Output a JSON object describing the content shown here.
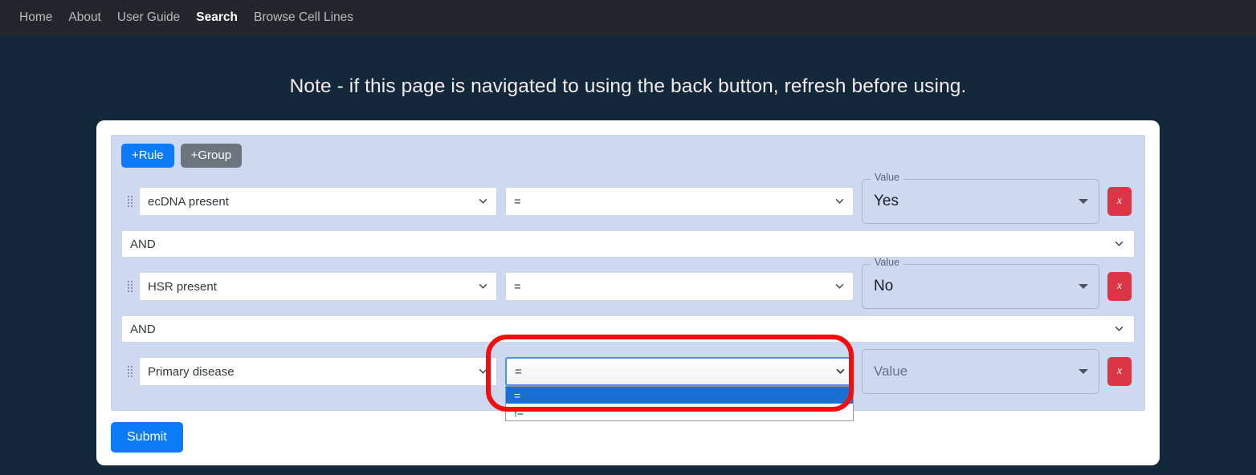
{
  "nav": {
    "items": [
      {
        "label": "Home",
        "active": false
      },
      {
        "label": "About",
        "active": false
      },
      {
        "label": "User Guide",
        "active": false
      },
      {
        "label": "Search",
        "active": true
      },
      {
        "label": "Browse Cell Lines",
        "active": false
      }
    ]
  },
  "page": {
    "note": "Note - if this page is navigated to using the back button, refresh before using.",
    "background_color": "#14283c"
  },
  "query_builder": {
    "add_rule_label": "+Rule",
    "add_group_label": "+Group",
    "remove_label": "x",
    "value_field_label": "Value",
    "value_placeholder": "Value",
    "accent_color": "#0d7bf7",
    "group_background": "#ccd9f0",
    "danger_color": "#dc3545",
    "rules": [
      {
        "field": "ecDNA present",
        "operator": "=",
        "value": "Yes",
        "has_value": true
      },
      {
        "field": "HSR present",
        "operator": "=",
        "value": "No",
        "has_value": true
      },
      {
        "field": "Primary disease",
        "operator": "=",
        "value": "Value",
        "has_value": false
      }
    ],
    "combinators": [
      {
        "value": "AND"
      },
      {
        "value": "AND"
      }
    ],
    "open_dropdown": {
      "selected": "=",
      "options": [
        {
          "label": "=",
          "selected": true
        },
        {
          "label": "!=",
          "selected": false
        }
      ]
    },
    "submit_label": "Submit"
  }
}
